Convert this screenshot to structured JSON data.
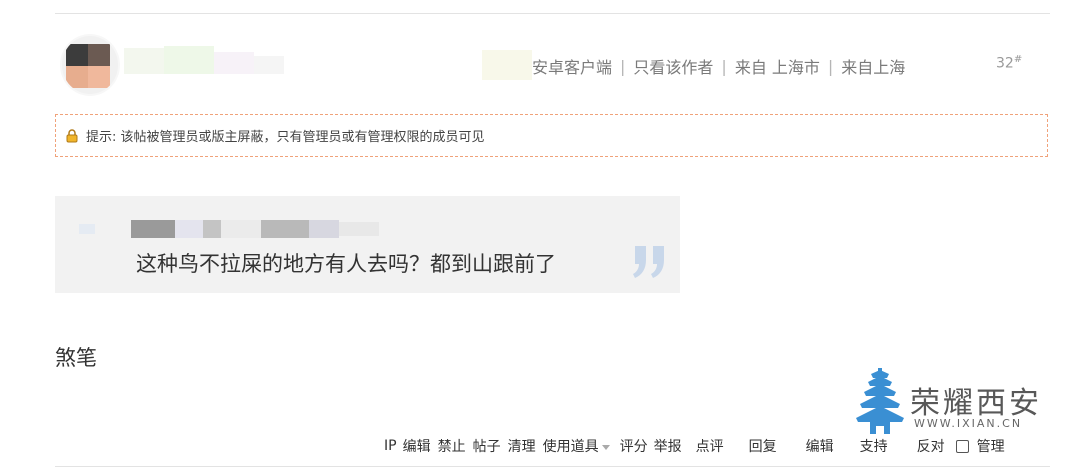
{
  "post": {
    "meta": {
      "client": "安卓客户端",
      "author_only": "只看该作者",
      "origin1": "来自 上海市",
      "origin2": "来自上海"
    },
    "floor_number": "32",
    "floor_symbol": "#",
    "notice": "提示: 该帖被管理员或版主屏蔽，只有管理员或有管理权限的成员可见",
    "quote_text": "这种鸟不拉屎的地方有人去吗？都到山跟前了",
    "reply_text": "煞笔"
  },
  "logo": {
    "title": "荣耀西安",
    "url": "WWW.IXIAN.CN"
  },
  "actions": {
    "ip": "IP",
    "edit_small": "编辑",
    "ban": "禁止",
    "posts": "帖子",
    "clean": "清理",
    "tools": "使用道具",
    "rate": "评分",
    "report": "举报",
    "comment": "点评",
    "reply": "回复",
    "edit": "编辑",
    "support": "支持",
    "oppose": "反对",
    "manage": "管理"
  },
  "icons": {
    "lock": "lock-icon",
    "quote": "quote-close-icon",
    "logo": "tower-icon",
    "caret": "chevron-down-icon"
  },
  "colors": {
    "notice_border": "#f0a27a",
    "quote_bg": "#f2f2f2",
    "quote_mark": "#c8d7ea",
    "logo_blue": "#3a8fd3"
  }
}
